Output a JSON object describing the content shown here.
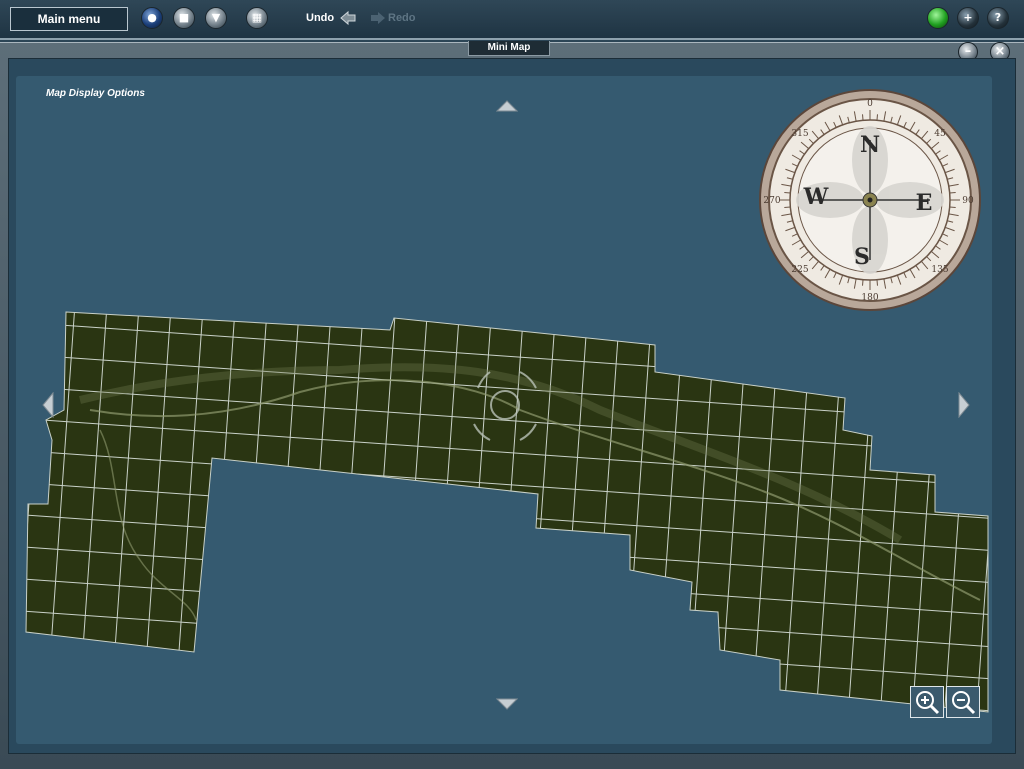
{
  "toolbar": {
    "main_menu_label": "Main menu",
    "undo_label": "Undo",
    "redo_label": "Redo"
  },
  "window": {
    "title": "Mini Map"
  },
  "map": {
    "options_label": "Map Display Options"
  },
  "compass": {
    "cardinals": [
      "N",
      "E",
      "S",
      "W"
    ],
    "degree_labels": [
      "0",
      "45",
      "90",
      "135",
      "180",
      "225",
      "270",
      "315"
    ]
  },
  "icons": {
    "toolbar": [
      "globe-icon",
      "stop-icon",
      "filter-icon",
      "grid-icon"
    ],
    "top_right": [
      "status-light-icon",
      "add-icon",
      "help-icon"
    ],
    "zoom": [
      "zoom-in-icon",
      "zoom-out-icon"
    ]
  },
  "colors": {
    "ocean": "#355a70",
    "terrain": "#2a3512",
    "grid": "#c9d1c8",
    "status_green": "#20a020"
  }
}
